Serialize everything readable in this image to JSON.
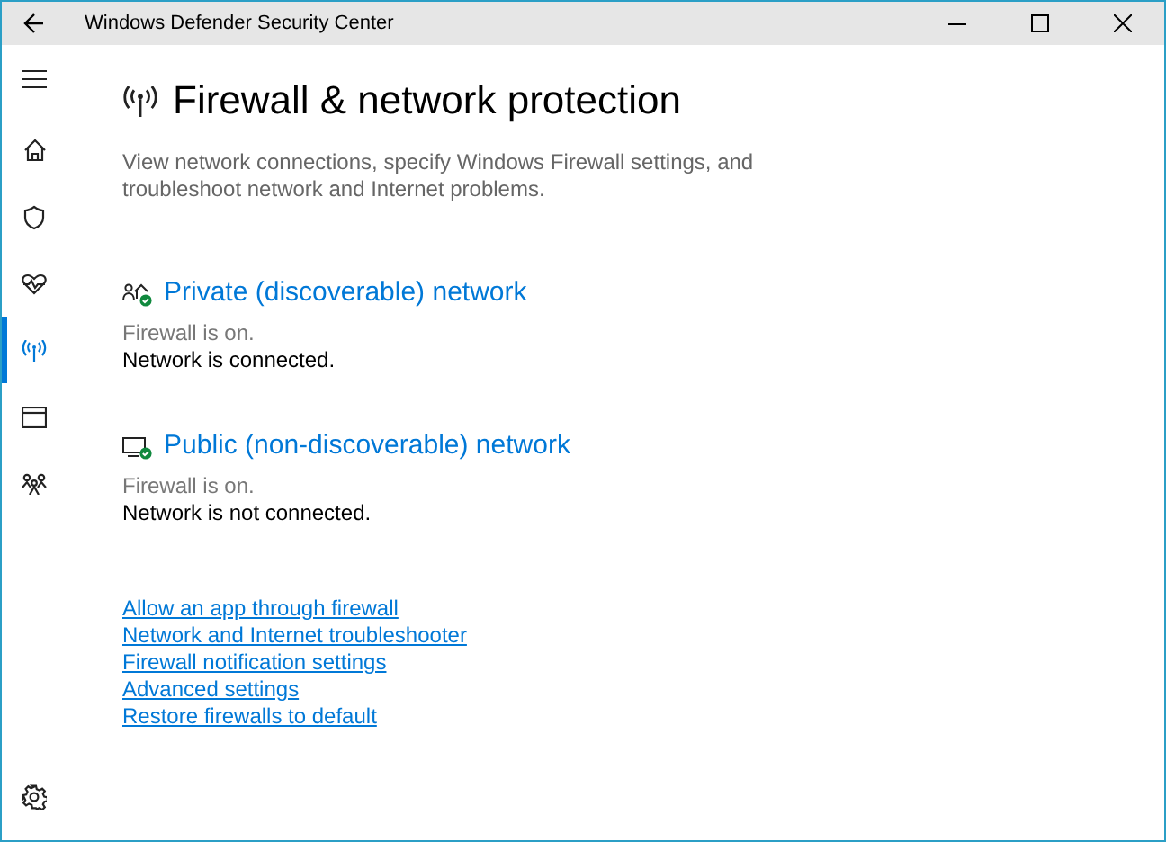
{
  "window": {
    "title": "Windows Defender Security Center"
  },
  "nav": [
    {
      "kind": "menu",
      "selected": false
    },
    {
      "kind": "home",
      "selected": false
    },
    {
      "kind": "shield",
      "selected": false
    },
    {
      "kind": "health",
      "selected": false
    },
    {
      "kind": "network",
      "selected": true
    },
    {
      "kind": "app",
      "selected": false
    },
    {
      "kind": "family",
      "selected": false
    },
    {
      "kind": "settings",
      "selected": false
    }
  ],
  "page": {
    "title": "Firewall & network protection",
    "description": "View network connections, specify Windows Firewall settings, and troubleshoot network and Internet problems."
  },
  "networks": [
    {
      "kind": "private",
      "title": "Private (discoverable) network",
      "firewall": "Firewall is on.",
      "connection": "Network is connected."
    },
    {
      "kind": "public",
      "title": "Public (non-discoverable) network",
      "firewall": "Firewall is on.",
      "connection": "Network is not connected."
    }
  ],
  "links": [
    "Allow an app through firewall",
    "Network and Internet troubleshooter",
    "Firewall notification settings",
    "Advanced settings",
    "Restore firewalls to default"
  ]
}
